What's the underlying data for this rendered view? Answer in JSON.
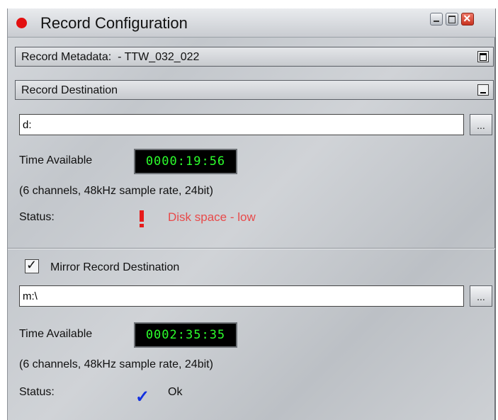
{
  "window": {
    "title": "Record Configuration"
  },
  "metadata_panel": {
    "label_prefix": "Record Metadata:  - ",
    "take_name": "TTW_032_022"
  },
  "destination_panel": {
    "label": "Record Destination",
    "path_value": "d:",
    "browse_label": "...",
    "time_available_label": "Time Available",
    "time_available_value": "0000:19:56",
    "format_info": "(6 channels, 48kHz sample rate, 24bit)",
    "status_label": "Status:",
    "status_text": "Disk space - low",
    "status_icon": "warning-exclamation-icon",
    "status_color": "#e84a4a"
  },
  "mirror": {
    "checkbox_label": "Mirror Record Destination",
    "checked": true,
    "path_value": "m:\\",
    "browse_label": "...",
    "time_available_label": "Time Available",
    "time_available_value": "0002:35:35",
    "format_info": "(6 channels, 48kHz sample rate, 24bit)",
    "status_label": "Status:",
    "status_text": "Ok",
    "status_icon": "checkmark-icon",
    "status_color": "#1230e0"
  }
}
